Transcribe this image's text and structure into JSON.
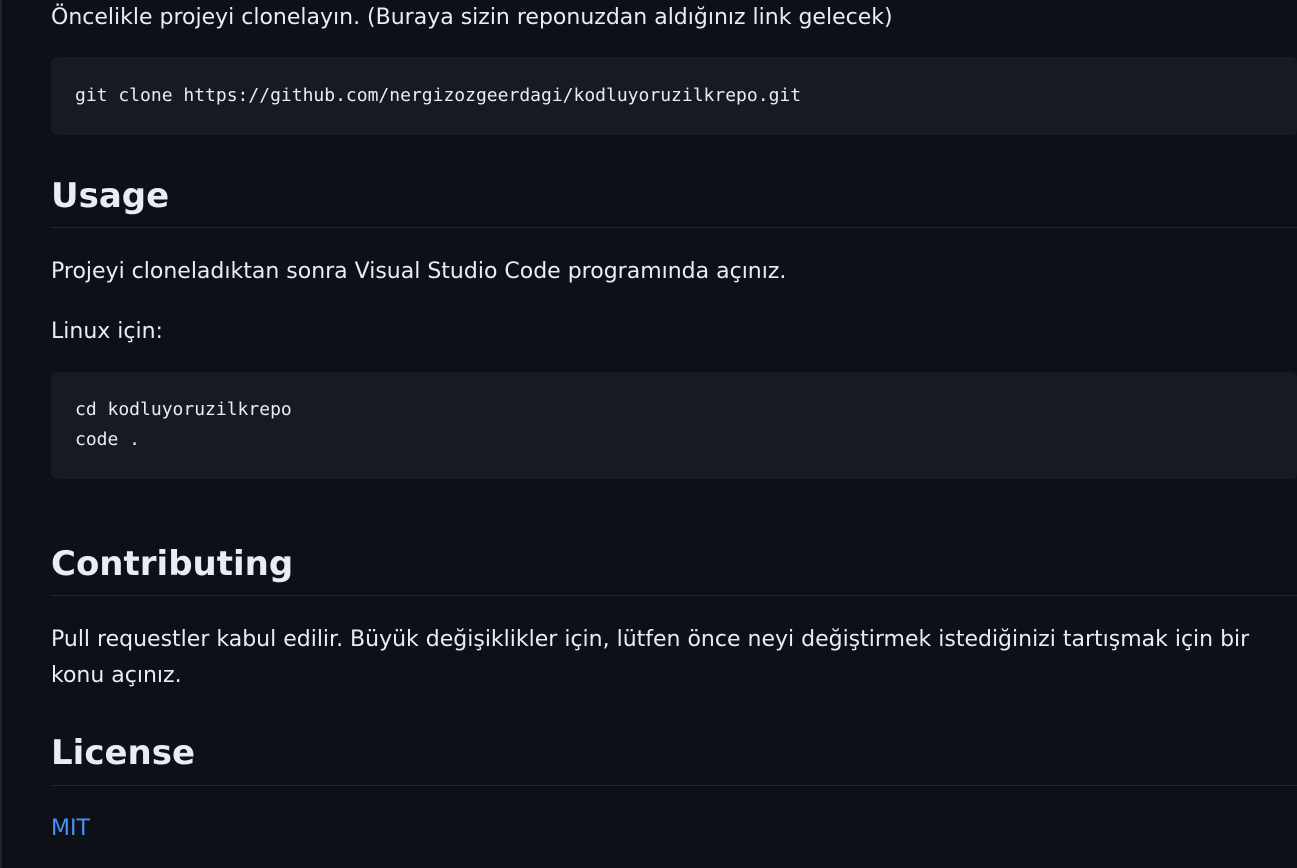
{
  "intro": {
    "text": "Öncelikle projeyi clonelayın. (Buraya sizin reponuzdan aldığınız link gelecek)"
  },
  "clone_code": {
    "lines": [
      "git clone https://github.com/nergizozgeerdagi/kodluyoruzilkrepo.git"
    ]
  },
  "usage": {
    "heading": "Usage",
    "paragraph": "Projeyi cloneladıktan sonra Visual Studio Code programında açınız.",
    "linux_label": "Linux için:",
    "code_lines": [
      "cd kodluyoruzilkrepo",
      "code ."
    ]
  },
  "contributing": {
    "heading": "Contributing",
    "paragraph": "Pull requestler kabul edilir. Büyük değişiklikler için, lütfen önce neyi değiştirmek istediğinizi tartışmak için bir konu açınız."
  },
  "license": {
    "heading": "License",
    "link_text": "MIT"
  },
  "colors": {
    "background": "#0d1117",
    "code_background": "#161b22",
    "text": "#e6edf3",
    "link": "#4493f8",
    "divider": "#21262d"
  }
}
